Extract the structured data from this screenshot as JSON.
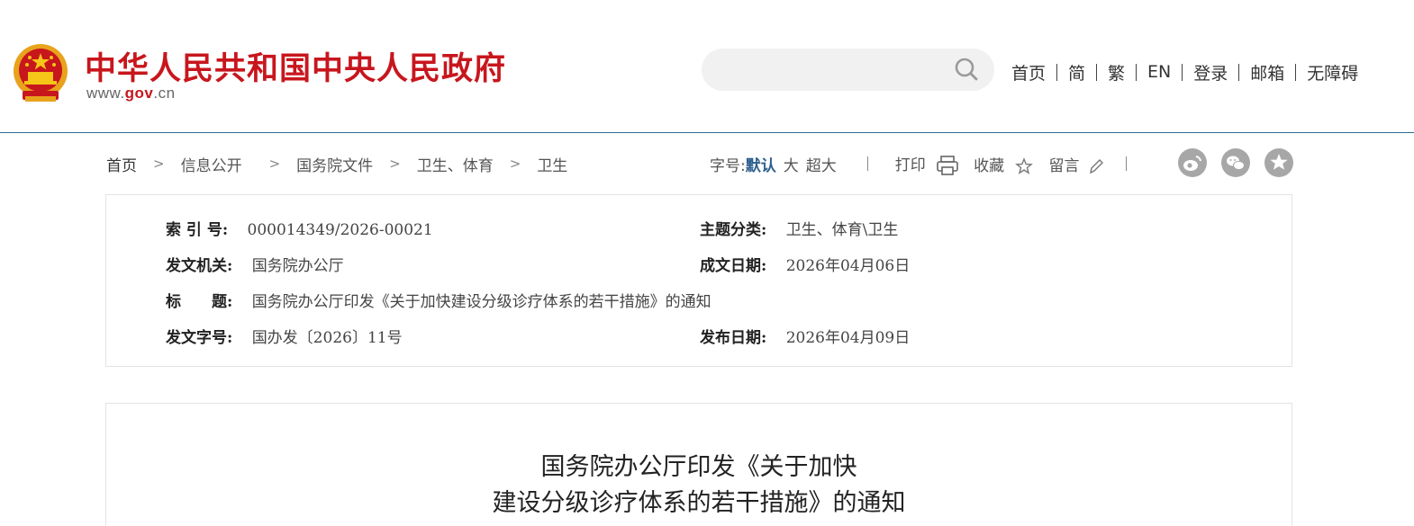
{
  "header": {
    "site_title": "中华人民共和国中央人民政府",
    "site_url_prefix": "www.",
    "site_url_domain": "gov",
    "site_url_suffix": ".cn",
    "brand_color": "#c8161d"
  },
  "search": {
    "placeholder": ""
  },
  "topnav": {
    "items": [
      "首页",
      "简",
      "繁",
      "EN",
      "登录",
      "邮箱",
      "无障碍"
    ]
  },
  "breadcrumb": {
    "items": [
      "首页",
      "信息公开",
      "国务院文件",
      "卫生、体育",
      "卫生"
    ]
  },
  "tools": {
    "font_size_label": "字号:",
    "font_default": "默认",
    "font_large": "大",
    "font_xlarge": "超大",
    "print": "打印",
    "favorite": "收藏",
    "comment": "留言"
  },
  "share_icons": [
    "weibo-icon",
    "wechat-icon",
    "qzone-icon"
  ],
  "info": {
    "index_label": "索 引 号:",
    "index_value": "000014349/2026-00021",
    "category_label": "主题分类:",
    "category_value": "卫生、体育\\卫生",
    "issuer_label": "发文机关:",
    "issuer_value": "国务院办公厅",
    "created_label": "成文日期:",
    "created_value": "2026年04月06日",
    "title_label": "标　　题:",
    "title_value": "国务院办公厅印发《关于加快建设分级诊疗体系的若干措施》的通知",
    "docno_label": "发文字号:",
    "docno_value": "国办发〔2026〕11号",
    "published_label": "发布日期:",
    "published_value": "2026年04月09日"
  },
  "article": {
    "title_line1": "国务院办公厅印发《关于加快",
    "title_line2": "建设分级诊疗体系的若干措施》的通知"
  },
  "colors": {
    "accent_blue": "#2c5f8e",
    "header_rule": "#2f6b96",
    "share_gray": "#a7a7a7"
  }
}
